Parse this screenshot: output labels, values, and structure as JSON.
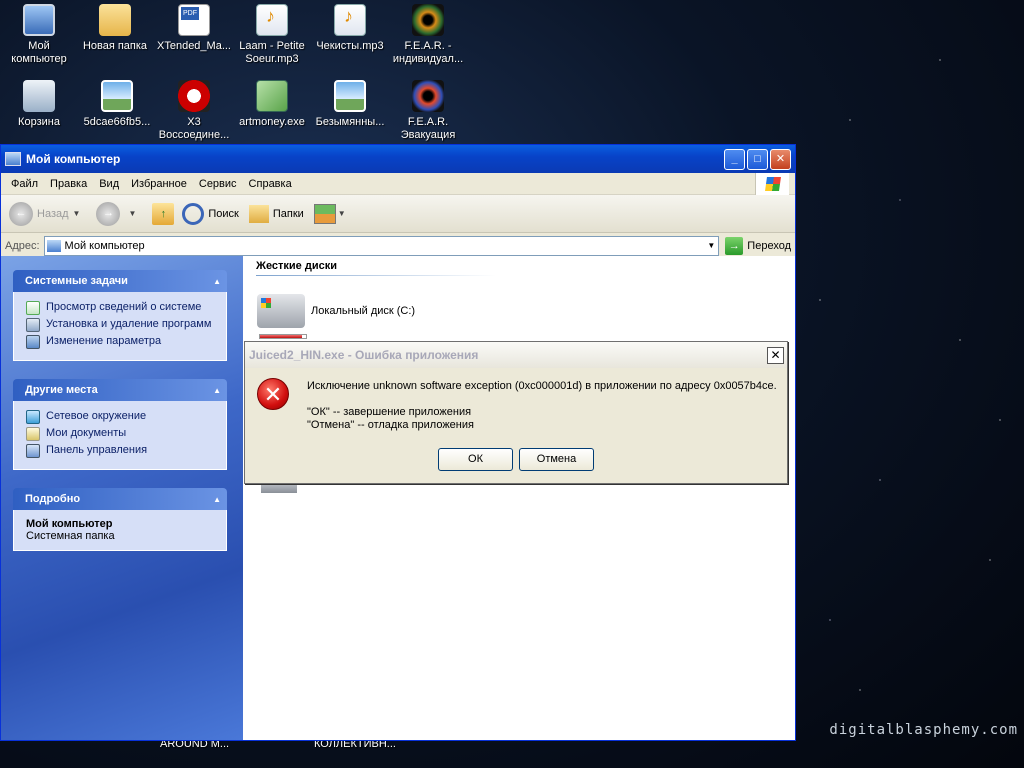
{
  "desktop": {
    "icons": [
      {
        "label": "Мой компьютер",
        "icon": "computer-icon"
      },
      {
        "label": "Новая папка",
        "icon": "folder-icon"
      },
      {
        "label": "XTended_Ma...",
        "icon": "pdf-icon"
      },
      {
        "label": "Laam - Petite Soeur.mp3",
        "icon": "mp3-icon"
      },
      {
        "label": "Чекисты.mp3",
        "icon": "mp3-icon"
      },
      {
        "label": "F.E.A.R. - индивидуал...",
        "icon": "fear-icon"
      },
      {
        "label": "Корзина",
        "icon": "recycle-bin-icon"
      },
      {
        "label": "5dcae66fb5...",
        "icon": "image-icon"
      },
      {
        "label": "X3 Воссоедине...",
        "icon": "x3-icon"
      },
      {
        "label": "artmoney.exe",
        "icon": "artmoney-icon"
      },
      {
        "label": "Безымянны...",
        "icon": "image-icon"
      },
      {
        "label": "F.E.A.R. Эвакуация",
        "icon": "fear-icon"
      }
    ],
    "peek_labels": [
      "AROUND M...",
      "КОЛЛЕКТИВН..."
    ],
    "watermark": "digitalblasphemy.com"
  },
  "window": {
    "title": "Мой компьютер",
    "menu": [
      "Файл",
      "Правка",
      "Вид",
      "Избранное",
      "Сервис",
      "Справка"
    ],
    "toolbar": {
      "back": "Назад",
      "search": "Поиск",
      "folders": "Папки"
    },
    "address": {
      "label": "Адрес:",
      "value": "Мой компьютер",
      "go": "Переход"
    },
    "taskpane": {
      "system_tasks": {
        "title": "Системные задачи",
        "items": [
          "Просмотр сведений о системе",
          "Установка и удаление программ",
          "Изменение параметра"
        ]
      },
      "other_places": {
        "title": "Другие места",
        "items": [
          "Сетевое окружение",
          "Мои документы",
          "Панель управления"
        ]
      },
      "details": {
        "title": "Подробно",
        "name": "Мой компьютер",
        "desc": "Системная папка"
      }
    },
    "main": {
      "section_title": "Жесткие диски",
      "drive_label": "Локальный диск (C:)",
      "drive_usage": 0.92
    }
  },
  "dialog": {
    "title": "Juiced2_HIN.exe - Ошибка приложения",
    "message": "Исключение unknown software exception (0xc000001d) в приложении по адресу 0x0057b4ce.",
    "line1": "\"ОК\" -- завершение приложения",
    "line2": "\"Отмена\" -- отладка приложения",
    "ok": "ОК",
    "cancel": "Отмена",
    "close": "✕"
  }
}
